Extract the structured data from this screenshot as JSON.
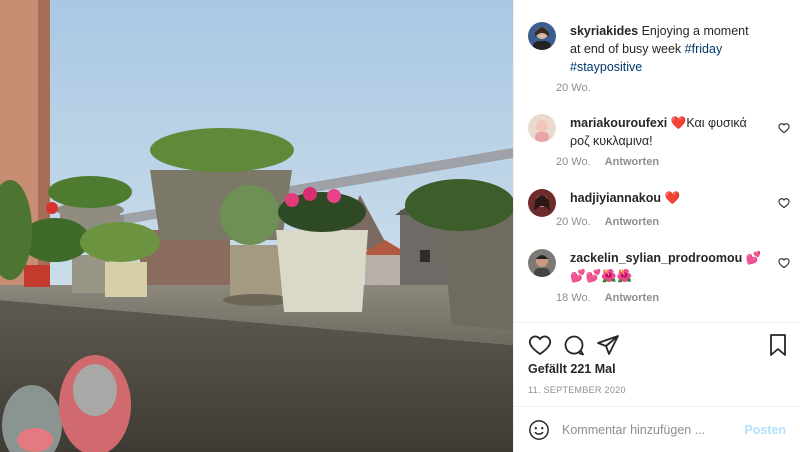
{
  "post": {
    "username": "skyriakides",
    "caption": "Enjoying a moment at end of busy week",
    "tags": [
      "#friday",
      "#staypositive"
    ],
    "age": "20 Wo."
  },
  "comments": [
    {
      "username": "mariakouroufexi",
      "text": "❤️Και φυσικά ροζ κυκλαμινα!",
      "age": "20 Wo.",
      "reply": "Antworten"
    },
    {
      "username": "hadjiyiannakou",
      "text": "❤️",
      "age": "20 Wo.",
      "reply": "Antworten"
    },
    {
      "username": "zackelin_sylian_prodroomou",
      "text": "💕💕💕🌺🌺",
      "age": "18 Wo.",
      "reply": "Antworten"
    }
  ],
  "likes": "Gefällt 221 Mal",
  "date": "11. SEPTEMBER 2020",
  "add_comment": {
    "placeholder": "Kommentar hinzufügen ...",
    "post_label": "Posten"
  },
  "icons": {
    "like": "heart-icon",
    "comment": "comment-icon",
    "share": "paper-plane-icon",
    "save": "bookmark-icon",
    "emoji": "smiley-icon",
    "comment_like": "heart-outline-icon"
  },
  "colors": {
    "hashtag": "#00376b",
    "muted": "#8e8e8e",
    "post_button": "#b2dffc",
    "heart": "#ed4956"
  }
}
